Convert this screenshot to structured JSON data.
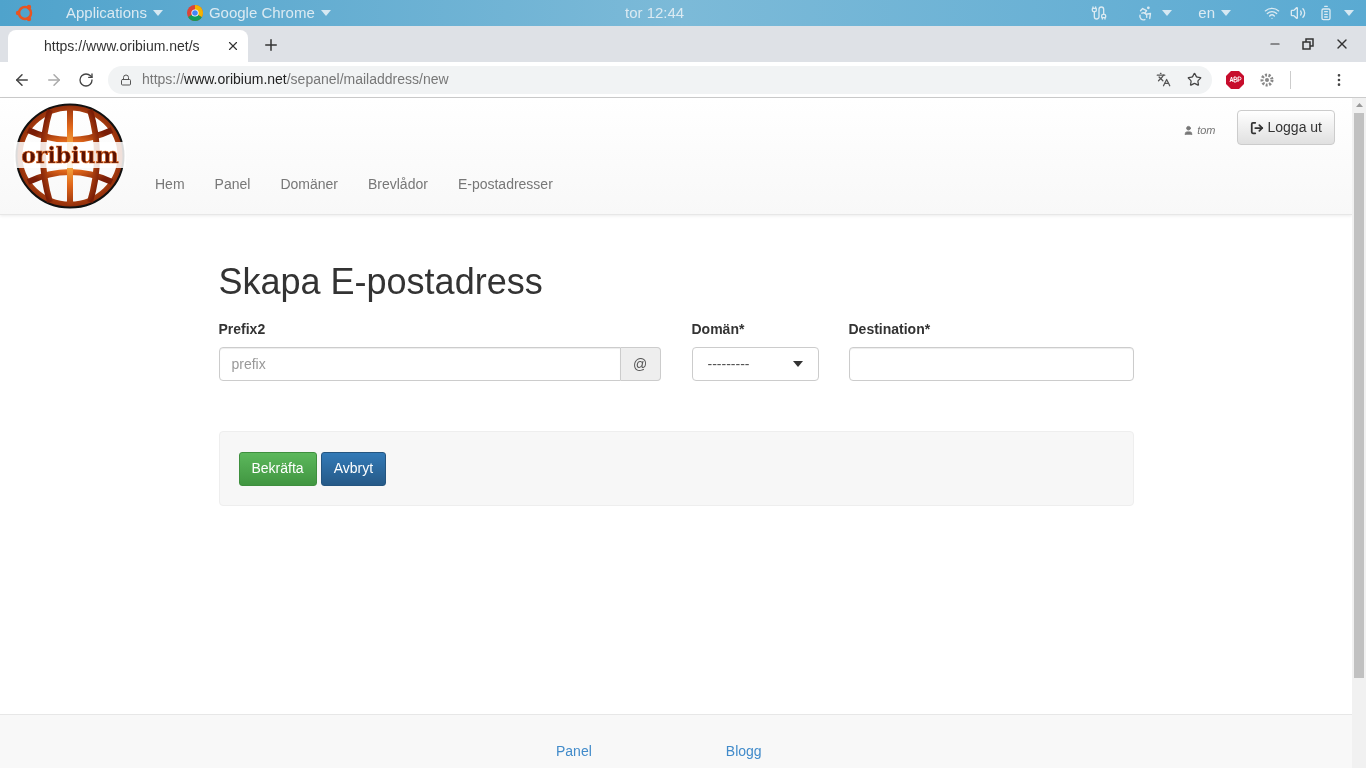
{
  "top_panel": {
    "apps_menu": "Applications",
    "app_menu": "Google Chrome",
    "clock": "tor 12:44",
    "language": "en"
  },
  "browser": {
    "tab_title": "https://www.oribium.net/s",
    "url": {
      "scheme": "https://",
      "host": "www.oribium.net",
      "path": "/sepanel/mailaddress/new"
    }
  },
  "navbar": {
    "logo_text": "oribium",
    "items": [
      {
        "label": "Hem"
      },
      {
        "label": "Panel"
      },
      {
        "label": "Domäner"
      },
      {
        "label": "Brevlådor"
      },
      {
        "label": "E-postadresser"
      }
    ],
    "user": "tom",
    "logout": "Logga ut"
  },
  "form": {
    "title": "Skapa E-postadress",
    "prefix": {
      "label": "Prefix2",
      "placeholder": "prefix",
      "addon": "@"
    },
    "domain": {
      "label": "Domän*",
      "value": "---------"
    },
    "destination": {
      "label": "Destination*"
    },
    "buttons": [
      {
        "label": "Bekräfta",
        "kind": "success"
      },
      {
        "label": "Avbryt",
        "kind": "primary"
      }
    ]
  },
  "footer": {
    "links": [
      "Panel",
      "Blogg"
    ]
  }
}
